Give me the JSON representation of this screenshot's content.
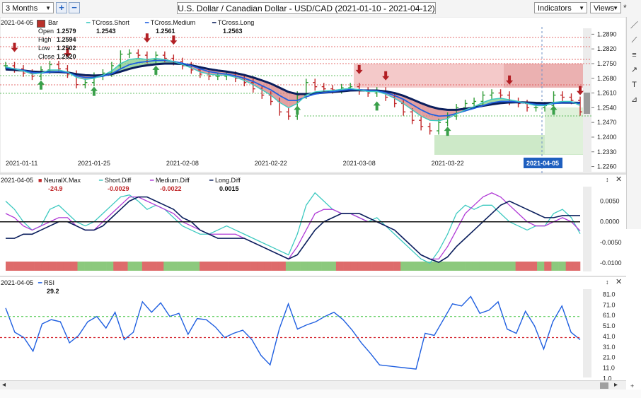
{
  "toolbar": {
    "period": "3 Months",
    "add_label": "+",
    "remove_label": "−",
    "title": "U.S. Dollar / Canadian Dollar - USD/CAD (2021-01-10 - 2021-04-12)",
    "indicators_label": "Indicators",
    "views_label": "Views",
    "pin_label": "*"
  },
  "right_tools": {
    "pencil": "pencil-icon",
    "ray": "ray-icon",
    "fib": "fib-icon",
    "arrow": "arrow-icon",
    "text": "text-icon",
    "ruler": "ruler-icon"
  },
  "legend_main": {
    "date": "2021-04-05",
    "bar_label": "Bar",
    "open_label": "Open",
    "open": "1.2579",
    "high_label": "High",
    "high": "1.2594",
    "low_label": "Low",
    "low": "1.2502",
    "close_label": "Close",
    "close": "1.2520",
    "short_name": "TCross.Short",
    "short_val": "1.2543",
    "medium_name": "TCross.Medium",
    "medium_val": "1.2561",
    "long_name": "TCross.Long",
    "long_val": "1.2563"
  },
  "legend_diff": {
    "date": "2021-04-05",
    "nx_name": "NeuralX.Max",
    "nx_val": "-24.9",
    "short_name": "Short.Diff",
    "short_val": "-0.0029",
    "medium_name": "Medium.Diff",
    "medium_val": "-0.0022",
    "long_name": "Long.Diff",
    "long_val": "0.0015"
  },
  "legend_rsi": {
    "date": "2021-04-05",
    "name": "RSI",
    "val": "29.2"
  },
  "x_labels": [
    "2021-01-11",
    "2021-01-25",
    "2021-02-08",
    "2021-02-22",
    "2021-03-08",
    "2021-03-22",
    "2021-04-05"
  ],
  "colors": {
    "short": "#3dc9c0",
    "medium": "#1f5fe0",
    "long": "#0a1e5c",
    "up": "#2e9b35",
    "down": "#c0282a",
    "rsi": "#1f5fe0",
    "medium_diff": "#b03ad6"
  },
  "chart_data": [
    {
      "type": "candlestick",
      "title": "U.S. Dollar / Canadian Dollar - USD/CAD",
      "x_ticks": [
        "2021-01-11",
        "2021-01-25",
        "2021-02-08",
        "2021-02-22",
        "2021-03-08",
        "2021-03-22",
        "2021-04-05"
      ],
      "y_ticks": [
        1.226,
        1.233,
        1.24,
        1.247,
        1.254,
        1.261,
        1.268,
        1.275,
        1.282,
        1.289
      ],
      "ylim": [
        1.2245,
        1.2925
      ],
      "close": [
        1.274,
        1.2725,
        1.2705,
        1.269,
        1.272,
        1.2745,
        1.2725,
        1.27,
        1.265,
        1.266,
        1.269,
        1.2705,
        1.274,
        1.2795,
        1.28,
        1.279,
        1.277,
        1.279,
        1.2775,
        1.276,
        1.274,
        1.272,
        1.27,
        1.269,
        1.269,
        1.2695,
        1.268,
        1.266,
        1.263,
        1.26,
        1.257,
        1.252,
        1.25,
        1.26,
        1.266,
        1.264,
        1.263,
        1.2625,
        1.2635,
        1.264,
        1.262,
        1.261,
        1.262,
        1.259,
        1.256,
        1.252,
        1.248,
        1.245,
        1.243,
        1.247,
        1.25,
        1.254,
        1.256,
        1.257,
        1.26,
        1.261,
        1.26,
        1.257,
        1.256,
        1.254,
        1.254,
        1.255,
        1.26,
        1.259,
        1.2575,
        1.252
      ],
      "series": [
        {
          "name": "TCross.Short",
          "values": [
            1.2735,
            1.2725,
            1.2715,
            1.27,
            1.2705,
            1.272,
            1.272,
            1.271,
            1.2685,
            1.2675,
            1.268,
            1.2695,
            1.2715,
            1.275,
            1.277,
            1.2775,
            1.277,
            1.2775,
            1.277,
            1.276,
            1.2745,
            1.273,
            1.271,
            1.27,
            1.2695,
            1.2695,
            1.2685,
            1.267,
            1.265,
            1.2625,
            1.26,
            1.2565,
            1.254,
            1.256,
            1.26,
            1.2615,
            1.262,
            1.2622,
            1.2628,
            1.2632,
            1.2625,
            1.2617,
            1.2617,
            1.2605,
            1.2585,
            1.256,
            1.253,
            1.25,
            1.248,
            1.2478,
            1.2488,
            1.251,
            1.253,
            1.2545,
            1.2565,
            1.258,
            1.2585,
            1.2578,
            1.257,
            1.256,
            1.255,
            1.255,
            1.2565,
            1.257,
            1.257,
            1.255
          ]
        },
        {
          "name": "TCross.Medium",
          "values": [
            1.273,
            1.2725,
            1.2718,
            1.2708,
            1.2705,
            1.271,
            1.2712,
            1.2708,
            1.2692,
            1.2684,
            1.2684,
            1.269,
            1.2702,
            1.2725,
            1.2745,
            1.2755,
            1.276,
            1.2765,
            1.2765,
            1.276,
            1.2752,
            1.274,
            1.2725,
            1.2712,
            1.2705,
            1.27,
            1.2692,
            1.268,
            1.2665,
            1.2645,
            1.2625,
            1.2598,
            1.2575,
            1.2575,
            1.2592,
            1.2605,
            1.2612,
            1.2617,
            1.2622,
            1.2627,
            1.2626,
            1.2622,
            1.262,
            1.2612,
            1.2598,
            1.258,
            1.2555,
            1.253,
            1.251,
            1.25,
            1.2502,
            1.2512,
            1.2525,
            1.2537,
            1.255,
            1.2563,
            1.257,
            1.257,
            1.2567,
            1.2562,
            1.2556,
            1.2554,
            1.256,
            1.2563,
            1.2564,
            1.2561
          ]
        },
        {
          "name": "TCross.Long",
          "values": [
            1.2722,
            1.272,
            1.2717,
            1.2712,
            1.271,
            1.271,
            1.271,
            1.2708,
            1.27,
            1.2695,
            1.2693,
            1.2695,
            1.27,
            1.2712,
            1.2725,
            1.2735,
            1.2742,
            1.2747,
            1.275,
            1.275,
            1.2748,
            1.2742,
            1.2733,
            1.2724,
            1.2717,
            1.2712,
            1.2705,
            1.2696,
            1.2684,
            1.267,
            1.2655,
            1.2635,
            1.2615,
            1.2605,
            1.2605,
            1.2608,
            1.2612,
            1.2615,
            1.2618,
            1.2622,
            1.2623,
            1.2622,
            1.2622,
            1.2618,
            1.261,
            1.2597,
            1.258,
            1.2562,
            1.2546,
            1.2535,
            1.253,
            1.253,
            1.2535,
            1.2541,
            1.2549,
            1.2556,
            1.2562,
            1.2565,
            1.2566,
            1.2565,
            1.2563,
            1.2562,
            1.2563,
            1.2564,
            1.2564,
            1.2563
          ]
        }
      ]
    },
    {
      "type": "line",
      "y_ticks": [
        0.005,
        0.0,
        -0.005,
        -0.01
      ],
      "ylim": [
        -0.0115,
        0.0085
      ],
      "series": [
        {
          "name": "Short.Diff",
          "values": [
            0.005,
            0.003,
            0.0,
            -0.002,
            -0.001,
            0.003,
            0.004,
            0.002,
            0.0,
            -0.001,
            0.0,
            0.002,
            0.004,
            0.006,
            0.0065,
            0.005,
            0.003,
            0.004,
            0.003,
            0.001,
            -0.001,
            -0.002,
            -0.003,
            -0.003,
            -0.002,
            -0.001,
            -0.002,
            -0.003,
            -0.004,
            -0.005,
            -0.006,
            -0.007,
            -0.008,
            -0.003,
            0.004,
            0.007,
            0.005,
            0.003,
            0.002,
            0.002,
            0.001,
            0.0,
            0.001,
            -0.001,
            -0.003,
            -0.005,
            -0.007,
            -0.009,
            -0.01,
            -0.007,
            -0.003,
            0.002,
            0.004,
            0.003,
            0.004,
            0.004,
            0.002,
            0.0,
            -0.001,
            -0.002,
            -0.001,
            -0.001,
            0.002,
            0.003,
            0.001,
            -0.0029
          ]
        },
        {
          "name": "Medium.Diff",
          "values": [
            0.002,
            0.001,
            -0.001,
            -0.002,
            -0.001,
            0.0,
            0.001,
            0.001,
            -0.001,
            -0.002,
            -0.002,
            0.0,
            0.002,
            0.004,
            0.006,
            0.006,
            0.005,
            0.004,
            0.003,
            0.002,
            0.0,
            -0.001,
            -0.002,
            -0.003,
            -0.003,
            -0.003,
            -0.003,
            -0.004,
            -0.005,
            -0.006,
            -0.007,
            -0.008,
            -0.009,
            -0.006,
            -0.002,
            0.002,
            0.003,
            0.003,
            0.002,
            0.002,
            0.001,
            0.0,
            0.0,
            -0.001,
            -0.002,
            -0.004,
            -0.006,
            -0.008,
            -0.009,
            -0.009,
            -0.006,
            -0.002,
            0.002,
            0.004,
            0.006,
            0.007,
            0.006,
            0.004,
            0.002,
            0.0,
            -0.001,
            -0.001,
            0.0,
            0.001,
            0.0,
            -0.0022
          ]
        },
        {
          "name": "Long.Diff",
          "values": [
            -0.004,
            -0.004,
            -0.003,
            -0.003,
            -0.002,
            -0.001,
            0.0,
            0.0,
            -0.001,
            -0.002,
            -0.002,
            -0.001,
            0.001,
            0.003,
            0.005,
            0.006,
            0.006,
            0.005,
            0.004,
            0.003,
            0.001,
            0.0,
            -0.002,
            -0.003,
            -0.004,
            -0.004,
            -0.004,
            -0.004,
            -0.005,
            -0.006,
            -0.007,
            -0.008,
            -0.009,
            -0.008,
            -0.005,
            -0.002,
            0.0,
            0.001,
            0.002,
            0.002,
            0.002,
            0.001,
            0.0,
            -0.001,
            -0.002,
            -0.004,
            -0.006,
            -0.008,
            -0.009,
            -0.0098,
            -0.0085,
            -0.006,
            -0.004,
            -0.002,
            0.0,
            0.002,
            0.004,
            0.005,
            0.004,
            0.003,
            0.002,
            0.001,
            0.001,
            0.0015,
            0.0015,
            0.0015
          ]
        }
      ],
      "neuralx_signs": [
        -1,
        -1,
        -1,
        -1,
        -1,
        -1,
        -1,
        -1,
        -1,
        -1,
        1,
        1,
        1,
        1,
        1,
        -1,
        -1,
        1,
        1,
        -1,
        -1,
        -1,
        1,
        1,
        1,
        1,
        1,
        -1,
        -1,
        -1,
        -1,
        -1,
        -1,
        -1,
        -1,
        -1,
        -1,
        -1,
        -1,
        1,
        1,
        1,
        1,
        1,
        1,
        1,
        -1,
        -1,
        -1,
        -1,
        -1,
        -1,
        -1,
        -1,
        -1,
        1,
        1,
        1,
        1,
        1,
        1,
        1,
        1,
        1,
        1,
        1,
        1,
        1,
        1,
        1,
        1,
        -1,
        -1,
        -1,
        1,
        -1,
        1,
        1,
        -1,
        -1
      ]
    },
    {
      "type": "line",
      "y_ticks": [
        81,
        71,
        61,
        51,
        41,
        31,
        21,
        11,
        1
      ],
      "ylim": [
        0,
        86
      ],
      "levels": [
        60,
        40
      ],
      "series": [
        {
          "name": "RSI",
          "values": [
            68,
            45,
            40,
            27,
            53,
            57,
            55,
            35,
            42,
            55,
            60,
            49,
            64,
            38,
            45,
            74,
            64,
            73,
            60,
            63,
            43,
            58,
            57,
            50,
            40,
            44,
            47,
            38,
            23,
            14,
            48,
            72,
            48,
            52,
            55,
            60,
            64,
            57,
            47,
            35,
            25,
            14,
            13,
            12,
            11,
            10,
            44,
            42,
            57,
            72,
            70,
            79,
            63,
            66,
            74,
            48,
            44,
            65,
            51,
            29,
            55,
            70,
            45,
            38
          ]
        }
      ]
    }
  ]
}
